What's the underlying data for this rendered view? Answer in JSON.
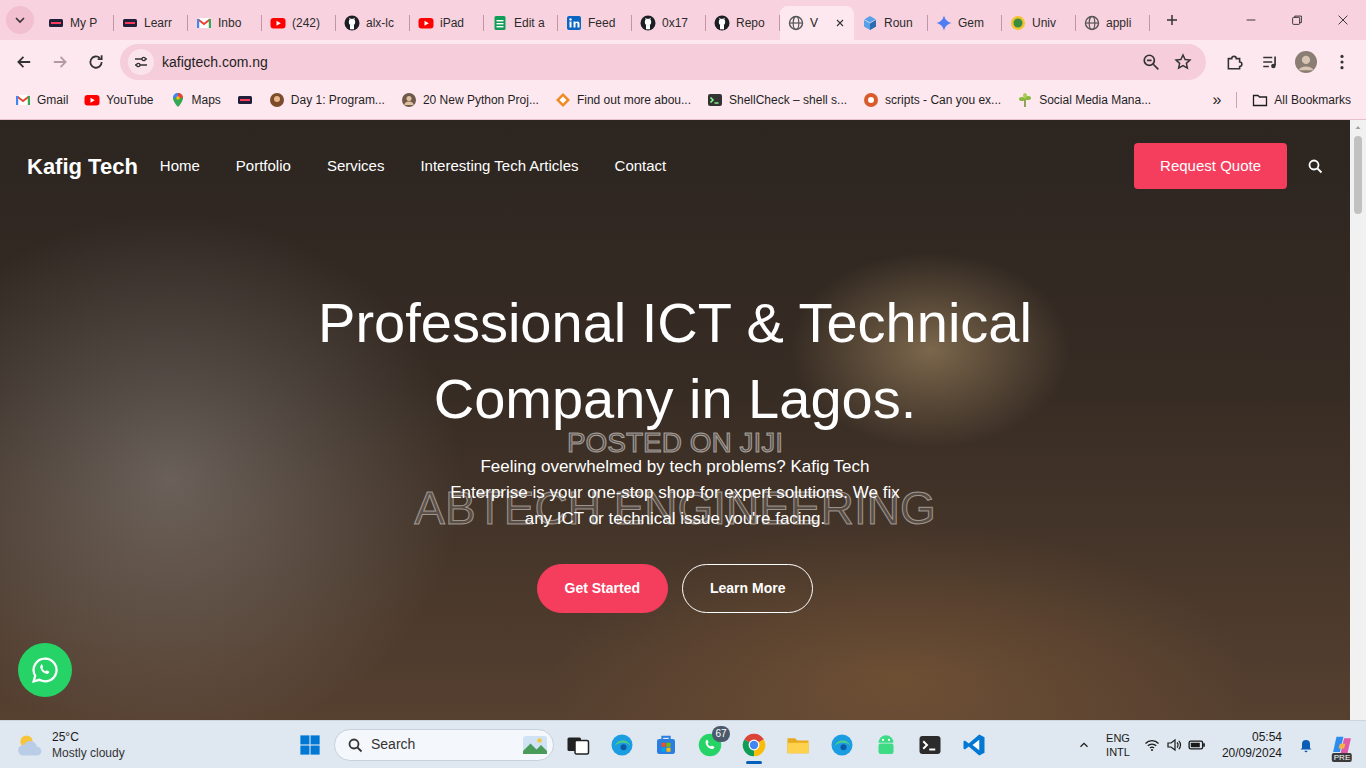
{
  "browser": {
    "tabs": [
      {
        "label": "My P",
        "kind": "alx",
        "selected": false
      },
      {
        "label": "Learr",
        "kind": "alx",
        "selected": false
      },
      {
        "label": "Inbo",
        "kind": "gmail",
        "selected": false
      },
      {
        "label": "(242)",
        "kind": "youtube",
        "selected": false
      },
      {
        "label": "alx-lc",
        "kind": "github",
        "selected": false
      },
      {
        "label": "iPad",
        "kind": "youtube",
        "selected": false
      },
      {
        "label": "Edit a",
        "kind": "sheet",
        "selected": false
      },
      {
        "label": "Feed",
        "kind": "linkedin",
        "selected": false
      },
      {
        "label": "0x17",
        "kind": "github",
        "selected": false
      },
      {
        "label": "Repo",
        "kind": "github",
        "selected": false
      },
      {
        "label": "V",
        "kind": "globe",
        "selected": true
      },
      {
        "label": "Roun",
        "kind": "box",
        "selected": false
      },
      {
        "label": "Gem",
        "kind": "gemini",
        "selected": false
      },
      {
        "label": "Univ",
        "kind": "university",
        "selected": false
      },
      {
        "label": "appli",
        "kind": "globe",
        "selected": false
      }
    ],
    "forward_disabled": true,
    "address": "kafigtech.com.ng",
    "bookmarks": [
      {
        "label": "Gmail",
        "kind": "gmail"
      },
      {
        "label": "YouTube",
        "kind": "youtube"
      },
      {
        "label": "Maps",
        "kind": "maps"
      },
      {
        "kind": "alx"
      },
      {
        "label": "Day 1: Program...",
        "kind": "fox"
      },
      {
        "label": "20 New Python Proj...",
        "kind": "avatar-photo"
      },
      {
        "label": "Find out more abou...",
        "kind": "diamond"
      },
      {
        "label": "ShellCheck – shell s...",
        "kind": "shellcheck"
      },
      {
        "label": "scripts - Can you ex...",
        "kind": "ask"
      },
      {
        "label": "Social Media Mana...",
        "kind": "plant"
      }
    ],
    "bookmarks_overflow": "»",
    "all_bookmarks": "All Bookmarks"
  },
  "site": {
    "brand": "Kafig Tech",
    "nav": [
      "Home",
      "Portfolio",
      "Services",
      "Interesting Tech Articles",
      "Contact"
    ],
    "quote_button": "Request Quote",
    "hero": {
      "title_lines": [
        "Professional ICT & Technical",
        "Company in Lagos."
      ],
      "subtitle": "Feeling overwhelmed by tech problems? Kafig Tech Enterprise is your one-stop shop for expert solutions. We fix any ICT or technical issue you're facing.",
      "buttons": [
        {
          "label": "Get Started",
          "kind": "primary"
        },
        {
          "label": "Learn More",
          "kind": "outline"
        }
      ]
    },
    "watermark": [
      "POSTED ON JIJI",
      "ABTECH ENGINEERING"
    ]
  },
  "taskbar": {
    "weather": {
      "temp": "25°C",
      "condition": "Mostly cloudy"
    },
    "search": "Search",
    "apps": [
      {
        "kind": "task-view",
        "active": false
      },
      {
        "kind": "edge",
        "active": false
      },
      {
        "kind": "store",
        "active": false
      },
      {
        "kind": "whatsapp",
        "active": false,
        "badge": "67"
      },
      {
        "kind": "chrome",
        "active": true
      },
      {
        "kind": "explorer",
        "active": false
      },
      {
        "kind": "edge",
        "active": false
      },
      {
        "kind": "android",
        "active": false
      },
      {
        "kind": "terminal",
        "active": false
      },
      {
        "kind": "vscode",
        "active": false
      }
    ],
    "tray": {
      "language": "ENG",
      "layout": "INTL",
      "time": "05:54",
      "date": "20/09/2024",
      "copilot_tag": "PRE"
    }
  }
}
